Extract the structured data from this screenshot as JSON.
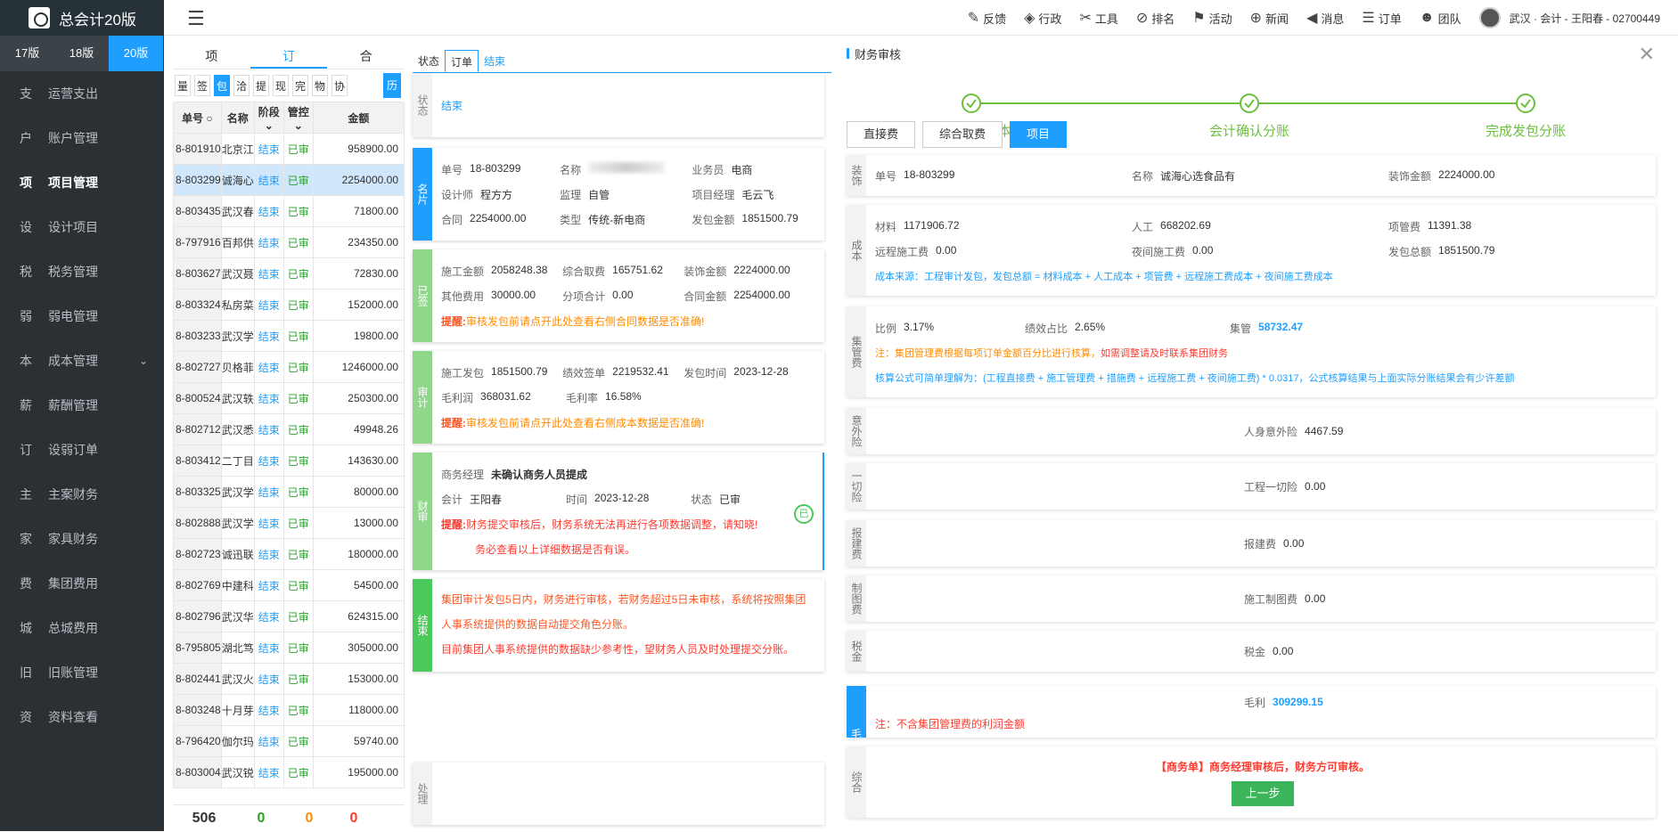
{
  "app": {
    "title": "总会计20版"
  },
  "topnav": [
    {
      "icon": "edit-icon",
      "label": "反馈"
    },
    {
      "icon": "layers-icon",
      "label": "行政"
    },
    {
      "icon": "tools-icon",
      "label": "工具"
    },
    {
      "icon": "compass-icon",
      "label": "排名"
    },
    {
      "icon": "flag-icon",
      "label": "活动"
    },
    {
      "icon": "globe-icon",
      "label": "新闻"
    },
    {
      "icon": "speaker-icon",
      "label": "消息"
    },
    {
      "icon": "clipboard-icon",
      "label": "订单"
    },
    {
      "icon": "team-icon",
      "label": "团队"
    }
  ],
  "user": {
    "text": "武汉 · 会计 - 王阳春 - 02700449"
  },
  "versions": [
    "17版",
    "18版",
    "20版"
  ],
  "menu": [
    {
      "k": "支",
      "label": "运营支出"
    },
    {
      "k": "户",
      "label": "账户管理"
    },
    {
      "k": "项",
      "label": "项目管理"
    },
    {
      "k": "设",
      "label": "设计项目"
    },
    {
      "k": "税",
      "label": "税务管理"
    },
    {
      "k": "弱",
      "label": "弱电管理"
    },
    {
      "k": "本",
      "label": "成本管理"
    },
    {
      "k": "薪",
      "label": "薪酬管理"
    },
    {
      "k": "订",
      "label": "设弱订单"
    },
    {
      "k": "主",
      "label": "主案财务"
    },
    {
      "k": "家",
      "label": "家具财务"
    },
    {
      "k": "费",
      "label": "集团费用"
    },
    {
      "k": "城",
      "label": "总城费用"
    },
    {
      "k": "旧",
      "label": "旧账管理"
    },
    {
      "k": "资",
      "label": "资料查看"
    }
  ],
  "col1": {
    "tabs": [
      "项",
      "订",
      "合"
    ],
    "filters": [
      "量",
      "签",
      "包",
      "洽",
      "提",
      "现",
      "完",
      "物",
      "协"
    ],
    "history": "历",
    "headers": [
      "单号",
      "名称",
      "阶段",
      "管控",
      "金额"
    ],
    "rows": [
      [
        "8-801910",
        "北京江",
        "结束",
        "已审",
        "958900.00"
      ],
      [
        "8-803299",
        "诚海心",
        "结束",
        "已审",
        "2254000.00"
      ],
      [
        "8-803435",
        "武汉春",
        "结束",
        "已审",
        "71800.00"
      ],
      [
        "8-797916",
        "百邦供",
        "结束",
        "已审",
        "234350.00"
      ],
      [
        "8-803627",
        "武汉聂",
        "结束",
        "已审",
        "72830.00"
      ],
      [
        "8-803324",
        "私房菜",
        "结束",
        "已审",
        "152000.00"
      ],
      [
        "8-803233",
        "武汉学",
        "结束",
        "已审",
        "19800.00"
      ],
      [
        "8-802727",
        "贝格菲",
        "结束",
        "已审",
        "1246000.00"
      ],
      [
        "8-800524",
        "武汉轶",
        "结束",
        "已审",
        "250300.00"
      ],
      [
        "8-802712",
        "武汉悉",
        "结束",
        "已审",
        "49948.26"
      ],
      [
        "8-803412",
        "二丁目",
        "结束",
        "已审",
        "143630.00"
      ],
      [
        "8-803325",
        "武汉学",
        "结束",
        "已审",
        "80000.00"
      ],
      [
        "8-802888",
        "武汉学",
        "结束",
        "已审",
        "13000.00"
      ],
      [
        "8-802723",
        "诚迅联",
        "结束",
        "已审",
        "180000.00"
      ],
      [
        "8-802769",
        "中建科",
        "结束",
        "已审",
        "54500.00"
      ],
      [
        "8-802796",
        "武汉华",
        "结束",
        "已审",
        "624315.00"
      ],
      [
        "8-795805",
        "湖北笃",
        "结束",
        "已审",
        "305000.00"
      ],
      [
        "8-802441",
        "武汉火",
        "结束",
        "已审",
        "153000.00"
      ],
      [
        "8-803248",
        "十月芽",
        "结束",
        "已审",
        "118000.00"
      ],
      [
        "8-796420",
        "伽尔玛",
        "结束",
        "已审",
        "59740.00"
      ],
      [
        "8-803004",
        "武汉锐",
        "结束",
        "已审",
        "195000.00"
      ]
    ],
    "footer": [
      "506",
      "0",
      "0",
      "0"
    ]
  },
  "col2": {
    "tabs": [
      "状态",
      "订单",
      "结束"
    ],
    "status": {
      "side": "状态",
      "value": "结束"
    },
    "card": {
      "side": "名片",
      "r1": [
        [
          "单号",
          "18-803299"
        ],
        [
          "名称",
          ""
        ],
        [
          "业务员",
          "电商"
        ]
      ],
      "r2": [
        [
          "设计师",
          "程方方"
        ],
        [
          "监理",
          "自管"
        ],
        [
          "项目经理",
          "毛云飞"
        ]
      ],
      "r3": [
        [
          "合同",
          "2254000.00"
        ],
        [
          "类型",
          "传统-新电商"
        ],
        [
          "发包金额",
          "1851500.79"
        ]
      ]
    },
    "signed": {
      "side": "已签",
      "r1": [
        [
          "施工金额",
          "2058248.38"
        ],
        [
          "综合取费",
          "165751.62"
        ],
        [
          "装饰金额",
          "2224000.00"
        ]
      ],
      "r2": [
        [
          "其他费用",
          "30000.00"
        ],
        [
          "分项合计",
          "0.00"
        ],
        [
          "合同金额",
          "2254000.00"
        ]
      ],
      "tip_label": "提醒:",
      "tip": "审核发包前请点开此处查看右侧合同数据是否准确!"
    },
    "audit": {
      "side": "审计",
      "r1": [
        [
          "施工发包",
          "1851500.79"
        ],
        [
          "绩效签单",
          "2219532.41"
        ],
        [
          "发包时间",
          "2023-12-28"
        ]
      ],
      "r2": [
        [
          "毛利润",
          "368031.62"
        ],
        [
          "毛利率",
          "16.58%"
        ]
      ],
      "tip_label": "提醒:",
      "tip": "审核发包前请点开此处查看右侧成本数据是否准确!"
    },
    "finance": {
      "side": "财审",
      "r1": [
        [
          "商务经理",
          "未确认商务人员提成"
        ]
      ],
      "r2": [
        [
          "会计",
          "王阳春"
        ],
        [
          "时间",
          "2023-12-28"
        ],
        [
          "状态",
          "已审"
        ]
      ],
      "tip_label": "提醒:",
      "tip": "财务提交审核后，财务系统无法再进行各项数据调整，请知晓!",
      "tip2": "务必查看以上详细数据是否有误。",
      "stamp": "已"
    },
    "end": {
      "side": "结束",
      "l1": "集团审计发包5日内，财务进行审核，若财务超过5日未审核，系统将按照集团",
      "l2": "人事系统提供的数据自动提交角色分账。",
      "l3": "目前集团人事系统提供的数据缺少参考性，望财务人员及时处理提交分账。"
    },
    "process": {
      "side": "处理"
    }
  },
  "col3": {
    "title": "财务审核",
    "steps": [
      "录入分项成本",
      "会计确认分账",
      "完成发包分账"
    ],
    "buttons": [
      "直接费",
      "综合取费",
      "项目"
    ],
    "deco": {
      "side": "装饰",
      "r": [
        [
          "单号",
          "18-803299"
        ],
        [
          "名称",
          "诚海心选食品有"
        ],
        [
          "装饰金额",
          "2224000.00"
        ]
      ]
    },
    "cost": {
      "side": "成本",
      "r1": [
        [
          "材料",
          "1171906.72"
        ],
        [
          "人工",
          "668202.69"
        ],
        [
          "项管费",
          "11391.38"
        ]
      ],
      "r2": [
        [
          "远程施工费",
          "0.00"
        ],
        [
          "夜间施工费",
          "0.00"
        ],
        [
          "发包总额",
          "1851500.79"
        ]
      ],
      "note": "成本来源：工程审计发包，发包总额 = 材料成本 + 人工成本 + 项管费 + 远程施工费成本 + 夜间施工费成本"
    },
    "group": {
      "side": "集管费",
      "r1": [
        [
          "比例",
          "3.17%"
        ],
        [
          "绩效占比",
          "2.65%"
        ],
        [
          "集管",
          "58732.47"
        ]
      ],
      "note1": "注：集团管理费根据每项订单金额百分比进行核算，",
      "note1b": "如需调整请及时联系集团财务",
      "note2": "核算公式可简单理解为：(工程直接费 + 施工管理费 + 措施费 + 远程施工费 + 夜间施工费) * 0.0317，公式核算结果与上面实际分账结果会有少许差额"
    },
    "accident": {
      "side": "意外险",
      "label": "人身意外险",
      "value": "4467.59"
    },
    "allrisk": {
      "side": "一切险",
      "label": "工程一切险",
      "value": "0.00"
    },
    "report": {
      "side": "报建费",
      "label": "报建费",
      "value": "0.00"
    },
    "drawing": {
      "side": "制图费",
      "label": "施工制图费",
      "value": "0.00"
    },
    "tax": {
      "side": "税金",
      "label": "税金",
      "value": "0.00"
    },
    "profit": {
      "side": "毛",
      "label": "毛利",
      "value": "309299.15",
      "note": "注：不含集团管理费的利润金额"
    },
    "summary": {
      "side": "综合",
      "text": "【商务单】商务经理审核后，财务方可审核。",
      "button": "上一步"
    }
  }
}
